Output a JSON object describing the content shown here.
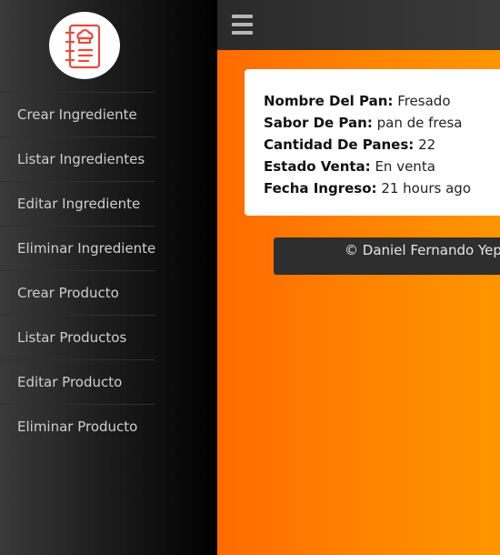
{
  "sidebar": {
    "logo_icon": "recipe-book-chef-icon",
    "items": [
      {
        "label": "Crear Ingrediente"
      },
      {
        "label": "Listar Ingredientes"
      },
      {
        "label": "Editar Ingrediente"
      },
      {
        "label": "Eliminar Ingrediente"
      },
      {
        "label": "Crear Producto"
      },
      {
        "label": "Listar Productos"
      },
      {
        "label": "Editar Producto"
      },
      {
        "label": "Eliminar Producto"
      }
    ]
  },
  "topbar": {
    "menu_icon": "hamburger-icon"
  },
  "card": {
    "fields": [
      {
        "label": "Nombre Del Pan:",
        "value": "Fresado"
      },
      {
        "label": "Sabor De Pan:",
        "value": "pan de fresa"
      },
      {
        "label": "Cantidad De Panes:",
        "value": "22"
      },
      {
        "label": "Estado Venta:",
        "value": "En venta"
      },
      {
        "label": "Fecha Ingreso:",
        "value": "21 hours ago"
      }
    ]
  },
  "footer": {
    "text": "© Daniel Fernando Yepe"
  },
  "colors": {
    "accent": "#ff7a00",
    "sidebar": "#1e1e1e",
    "logo_red": "#e74c3c"
  }
}
